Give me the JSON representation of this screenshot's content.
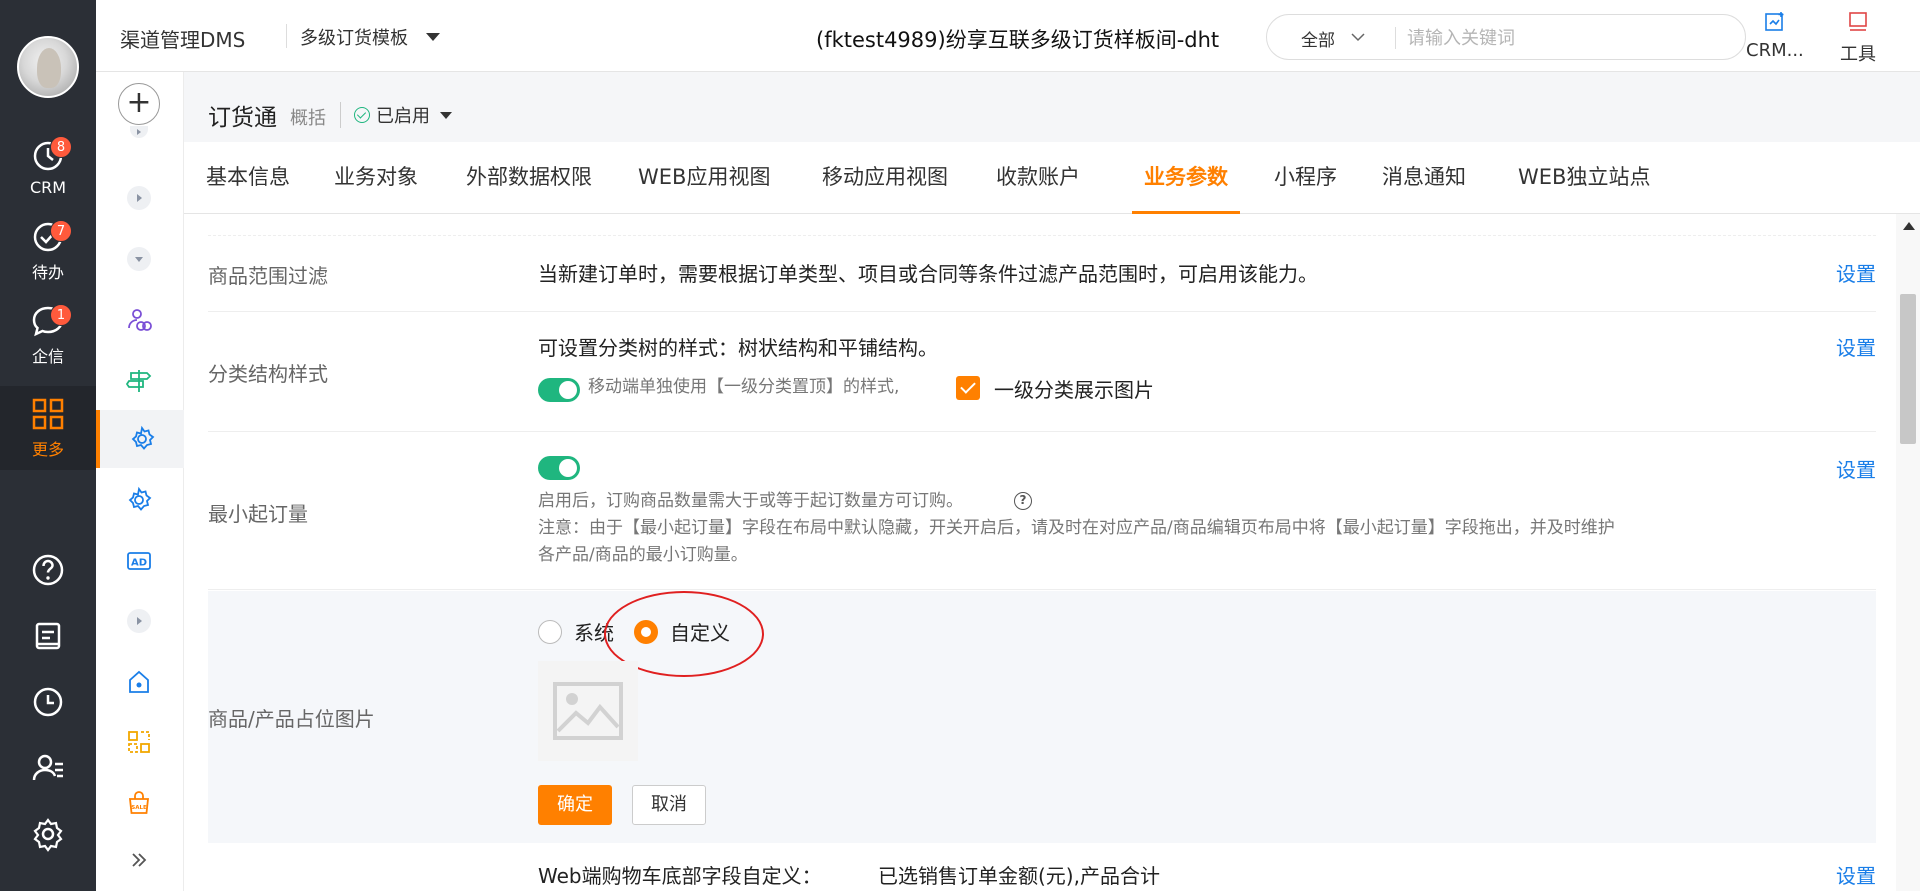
{
  "rail": {
    "items": [
      {
        "label": "CRM",
        "badge": "8",
        "icon": "clock-icon"
      },
      {
        "label": "待办",
        "badge": "7",
        "icon": "check-circle-icon"
      },
      {
        "label": "企信",
        "badge": "1",
        "icon": "chat-icon"
      },
      {
        "label": "更多",
        "badge": "",
        "icon": "grid-icon"
      }
    ],
    "tools": [
      "help-icon",
      "notes-icon",
      "history-icon",
      "user-list-icon",
      "settings-icon"
    ]
  },
  "topbar": {
    "app_name": "渠道管理DMS",
    "template": "多级订货模板",
    "tenant": "(fktest4989)纷享互联多级订货样板间-dht",
    "search_scope": "全部",
    "search_placeholder": "请输入关键词",
    "tool_crm": "CRM...",
    "tool_tools": "工具"
  },
  "subhead": {
    "title": "订货通",
    "overview": "概括",
    "status": "已启用"
  },
  "tabs": [
    "基本信息",
    "业务对象",
    "外部数据权限",
    "WEB应用视图",
    "移动应用视图",
    "收款账户",
    "业务参数",
    "小程序",
    "消息通知",
    "WEB独立站点"
  ],
  "active_tab": "业务参数",
  "settings": {
    "product_filter": {
      "label": "商品范围过滤",
      "desc": "当新建订单时，需要根据订单类型、项目或合同等条件过滤产品范围时，可启用该能力。",
      "action": "设置"
    },
    "category_style": {
      "label": "分类结构样式",
      "desc": "可设置分类树的样式：树状结构和平铺结构。",
      "toggle_note": "移动端单独使用【一级分类置顶】的样式,",
      "checkbox_label": "一级分类展示图片",
      "action": "设置"
    },
    "min_order": {
      "label": "最小起订量",
      "note1": "启用后，订购商品数量需大于或等于起订数量方可订购。",
      "note2": "注意：由于【最小起订量】字段在布局中默认隐藏，开关开启后，请及时在对应产品/商品编辑页布局中将【最小起订量】字段拖出，并及时维护",
      "note3": "各产品/商品的最小订购量。",
      "action": "设置"
    },
    "placeholder_image": {
      "label": "商品/产品占位图片",
      "option_system": "系统",
      "option_custom": "自定义",
      "confirm": "确定",
      "cancel": "取消"
    },
    "cart_footer": {
      "label": "Web端购物车底部字段自定义：",
      "value": "已选销售订单金额(元),产品合计",
      "action": "设置"
    }
  },
  "colors": {
    "accent": "#ff8000",
    "link": "#1a7ee8",
    "rail_bg": "#2b2f36",
    "toggle_on": "#1fb67f",
    "badge": "#ff5a3c",
    "annotation": "#e02020"
  }
}
